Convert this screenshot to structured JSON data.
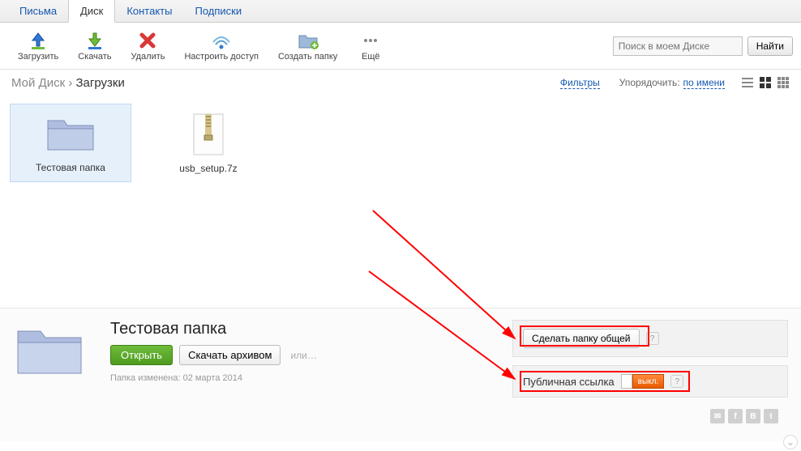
{
  "tabs": {
    "mail": "Письма",
    "disk": "Диск",
    "contacts": "Контакты",
    "subs": "Подписки"
  },
  "toolbar": {
    "upload": "Загрузить",
    "download": "Скачать",
    "delete": "Удалить",
    "access": "Настроить доступ",
    "newfolder": "Создать папку",
    "more": "Ещё",
    "search_placeholder": "Поиск в моем Диске",
    "find": "Найти"
  },
  "breadcrumb": {
    "root": "Мой Диск",
    "sep": "›",
    "current": "Загрузки"
  },
  "subbar": {
    "filters": "Фильтры",
    "sort_label": "Упорядочить:",
    "sort_value": "по имени"
  },
  "files": {
    "folder_name": "Тестовая папка",
    "file_name": "usb_setup.7z"
  },
  "details": {
    "title": "Тестовая папка",
    "open": "Открыть",
    "archive": "Скачать архивом",
    "or": "или…",
    "meta": "Папка изменена: 02 марта 2014",
    "share_btn": "Сделать папку общей",
    "public_label": "Публичная ссылка",
    "toggle_state": "выкл.",
    "help": "?"
  }
}
